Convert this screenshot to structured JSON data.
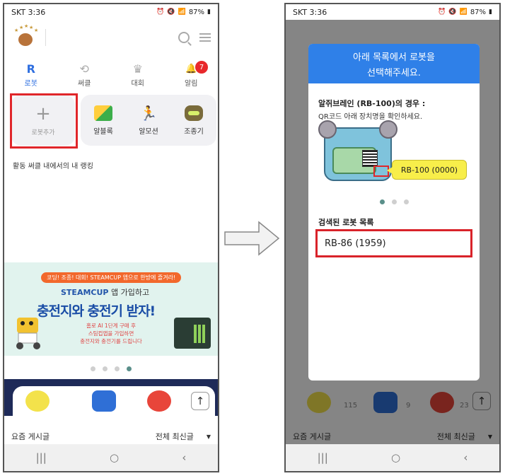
{
  "left": {
    "status": {
      "carrier": "SKT 3:36",
      "battery": "87%"
    },
    "tabs": [
      {
        "icon": "R",
        "label": "로봇"
      },
      {
        "icon": "⟲",
        "label": "써클"
      },
      {
        "icon": "♛",
        "label": "대회"
      },
      {
        "icon": "🔔",
        "label": "알림",
        "badge": "7"
      }
    ],
    "add_robot_label": "로봇추가",
    "apps": [
      {
        "label": "알블록"
      },
      {
        "label": "알모션"
      },
      {
        "label": "조종기"
      }
    ],
    "ranking_title": "활동 써클 내에서의 내 랭킹",
    "banner": {
      "pill": "코딩! 조종! 대회! STEAMCUP 앱으로 한방에 즐겨라!",
      "brand": "STEAMCUP",
      "line2_rest": "앱 가입하고",
      "big": "충전지와 충전기 받자!",
      "small": "홈로 AI 1단계 구매 후\n스팀컵앱을 가입하면\n충전지와 충전기를 드립니다"
    },
    "board": {
      "title": "요즘 게시글",
      "filter": "전체 최신글"
    }
  },
  "right": {
    "status": {
      "carrier": "SKT 3:36",
      "battery": "87%"
    },
    "modal": {
      "title_line1": "아래 목록에서 로봇을",
      "title_line2": "선택해주세요.",
      "case_title": "알쥐브레인 (RB-100)의 경우 :",
      "case_desc": "QR코드 아래 장치명을 확인하세요.",
      "device_label": "RB-100 (0000)",
      "found_title": "검색된 로봇 목록",
      "found_items": [
        "RB-86 (1959)"
      ]
    },
    "behind": {
      "n1": "115",
      "n2": "9",
      "n3": "23",
      "board_title": "요즘 게시글",
      "board_filter": "전체 최신글"
    }
  },
  "nav": {
    "recent": "|||",
    "home": "○",
    "back": "‹"
  },
  "colors": {
    "accent": "#2f80e8",
    "highlight_red": "#e0262a",
    "badge": "#e8282b"
  }
}
